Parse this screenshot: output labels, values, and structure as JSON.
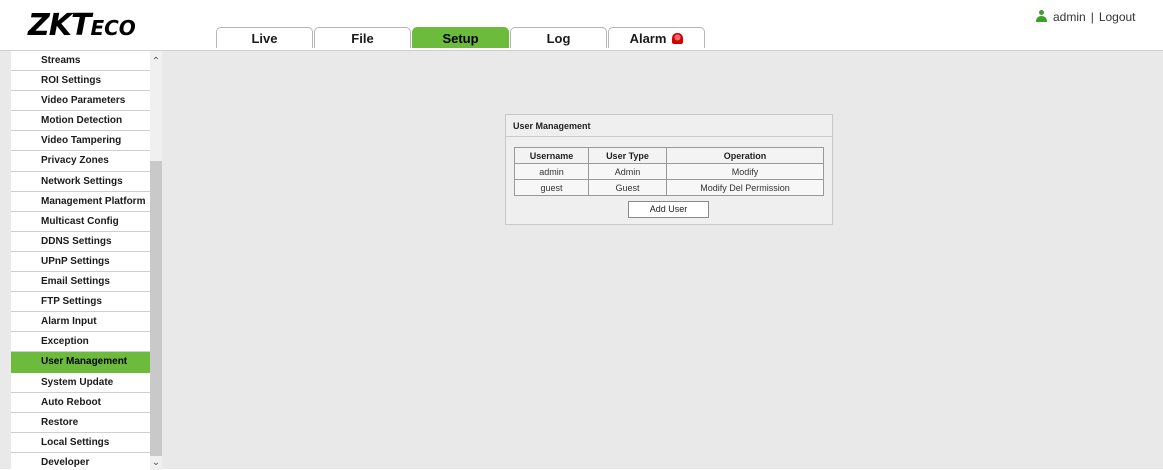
{
  "header": {
    "logo_text": "ZKTeco",
    "tabs": [
      {
        "label": "Live"
      },
      {
        "label": "File"
      },
      {
        "label": "Setup"
      },
      {
        "label": "Log"
      },
      {
        "label": "Alarm"
      }
    ],
    "active_tab": "Setup",
    "user": {
      "name": "admin",
      "separator": "|",
      "logout_label": "Logout"
    }
  },
  "sidebar": {
    "items": [
      {
        "label": "Streams"
      },
      {
        "label": "ROI Settings"
      },
      {
        "label": "Video Parameters"
      },
      {
        "label": "Motion Detection"
      },
      {
        "label": "Video Tampering"
      },
      {
        "label": "Privacy Zones"
      },
      {
        "label": "Network Settings"
      },
      {
        "label": "Management Platform"
      },
      {
        "label": "Multicast Config"
      },
      {
        "label": "DDNS Settings"
      },
      {
        "label": "UPnP Settings"
      },
      {
        "label": "Email Settings"
      },
      {
        "label": "FTP Settings"
      },
      {
        "label": "Alarm Input"
      },
      {
        "label": "Exception"
      },
      {
        "label": "User Management"
      },
      {
        "label": "System Update"
      },
      {
        "label": "Auto Reboot"
      },
      {
        "label": "Restore"
      },
      {
        "label": "Local Settings"
      },
      {
        "label": "Developer"
      }
    ],
    "active_item": "User Management"
  },
  "panel": {
    "title": "User Management",
    "columns": [
      "Username",
      "User Type",
      "Operation"
    ],
    "rows": [
      {
        "username": "admin",
        "user_type": "Admin",
        "operation": "Modify"
      },
      {
        "username": "guest",
        "user_type": "Guest",
        "operation": "Modify Del Permission"
      }
    ],
    "add_button_label": "Add User"
  },
  "colors": {
    "accent": "#6cbb3c",
    "background": "#e9e9e9"
  }
}
